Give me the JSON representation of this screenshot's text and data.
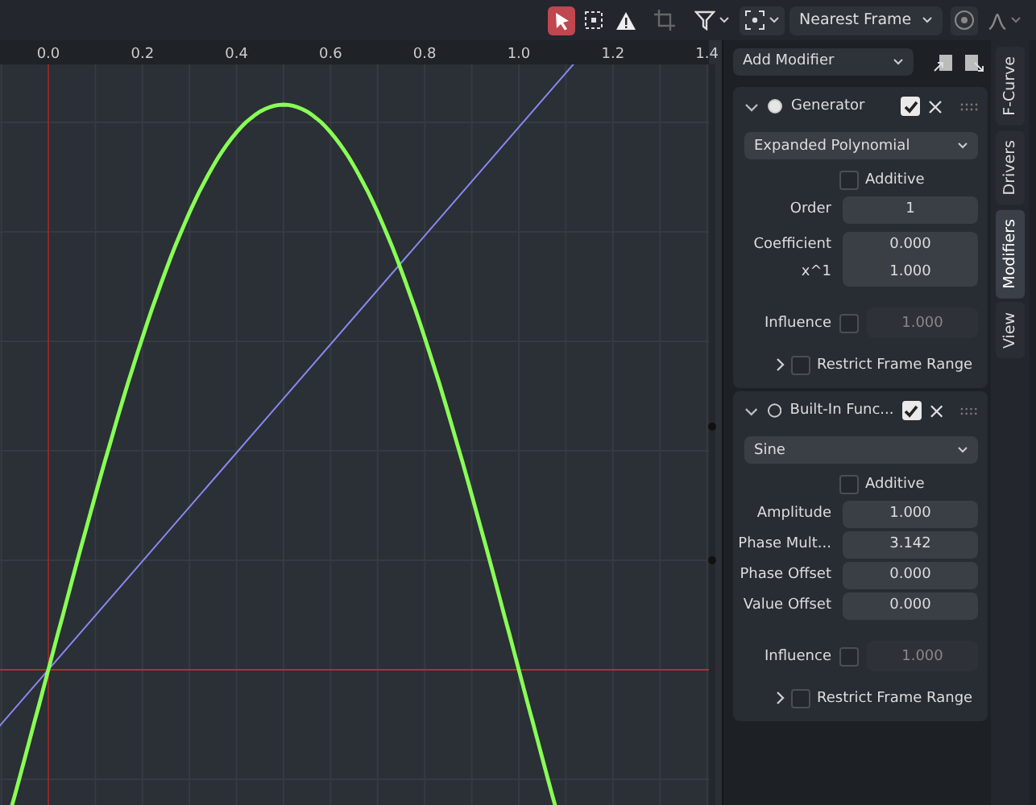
{
  "toolbar": {
    "tools": [
      {
        "kind": "cursor",
        "selected": true
      },
      {
        "kind": "box",
        "selected": false
      },
      {
        "kind": "warning",
        "selected": false
      }
    ],
    "snapping": "Nearest Frame"
  },
  "graph": {
    "x_ticks": [
      "0.0",
      "0.2",
      "0.4",
      "0.6",
      "0.8",
      "1.0",
      "1.2",
      "1.4"
    ]
  },
  "panel": {
    "add_modifier": "Add Modifier",
    "tabs": [
      {
        "label": "F-Curve",
        "selected": false
      },
      {
        "label": "Drivers",
        "selected": false
      },
      {
        "label": "Modifiers",
        "selected": true
      },
      {
        "label": "View",
        "selected": false
      }
    ],
    "modifiers": [
      {
        "name": "Generator",
        "expanded": true,
        "active": true,
        "enabled": true,
        "mode": "Expanded Polynomial",
        "additive": {
          "label": "Additive",
          "checked": false
        },
        "field_groups": [
          [
            {
              "label": "Order",
              "value": "1"
            }
          ],
          [
            {
              "label": "Coefficient",
              "value": "0.000"
            },
            {
              "label": "x^1",
              "value": "1.000"
            }
          ]
        ],
        "influence": {
          "label": "Influence",
          "checked": false,
          "value": "1.000"
        },
        "restrict": {
          "label": "Restrict Frame Range",
          "checked": false,
          "expanded": false
        }
      },
      {
        "name": "Built-In Func...",
        "expanded": true,
        "active": false,
        "enabled": true,
        "mode": "Sine",
        "additive": {
          "label": "Additive",
          "checked": false
        },
        "field_groups": [
          [
            {
              "label": "Amplitude",
              "value": "1.000"
            }
          ],
          [
            {
              "label": "Phase Mult...",
              "value": "3.142"
            }
          ],
          [
            {
              "label": "Phase Offset",
              "value": "0.000"
            }
          ],
          [
            {
              "label": "Value Offset",
              "value": "0.000"
            }
          ]
        ],
        "influence": {
          "label": "Influence",
          "checked": false,
          "value": "1.000"
        },
        "restrict": {
          "label": "Restrict Frame Range",
          "checked": false,
          "expanded": false
        }
      }
    ]
  }
}
